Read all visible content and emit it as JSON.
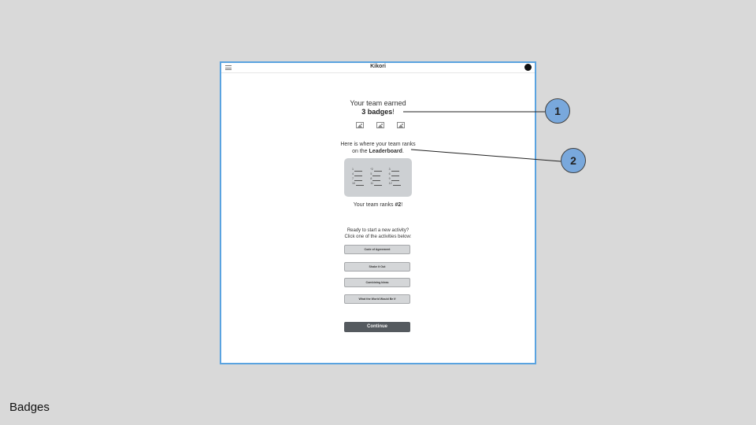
{
  "app": {
    "title": "Kikori",
    "menu_icon": "hamburger-icon",
    "profile_icon": "profile-avatar"
  },
  "summary": {
    "earned_prefix": "Your team earned",
    "badge_count_text": "3 badges",
    "earned_suffix": "!",
    "badges": [
      "image-icon",
      "image-icon",
      "image-icon"
    ]
  },
  "leaderboard": {
    "intro_line1": "Here is where your team ranks",
    "intro_line2_prefix": "on the ",
    "intro_line2_bold": "Leaderboard",
    "intro_line2_suffix": ".",
    "entries": [
      "1",
      "*2",
      "3",
      "4",
      "5",
      "6",
      "7",
      "8",
      "9",
      "10",
      "11",
      "12"
    ],
    "rank_prefix": "Your team ranks ",
    "rank_value": "#2",
    "rank_suffix": "!"
  },
  "activities": {
    "prompt_line1": "Ready to start a new activity?",
    "prompt_line2": "Click one of the activities below:",
    "buttons": [
      "Code of Agreement",
      "Shake it Out",
      "Combining Ideas",
      "What the World Would Be If"
    ]
  },
  "continue_label": "Continue",
  "callouts": [
    "1",
    "2"
  ],
  "caption": "Badges",
  "colors": {
    "frame_border": "#5aa3e0",
    "callout_fill": "#79a8dc",
    "continue_button": "#555a5f",
    "leaderboard_bg": "#cdd0d3"
  }
}
